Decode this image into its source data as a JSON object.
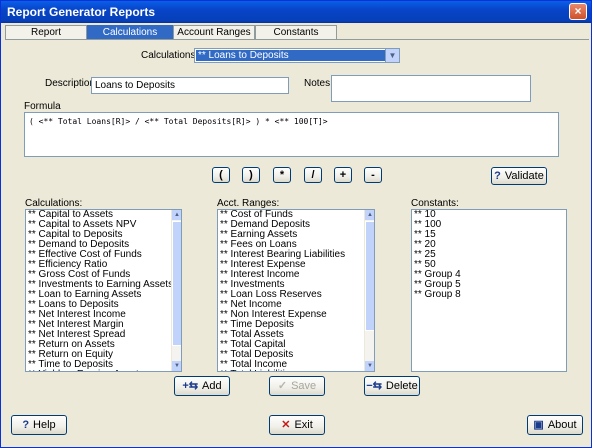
{
  "window": {
    "title": "Report Generator Reports",
    "close_glyph": "×"
  },
  "tabs": [
    {
      "label": "Report",
      "active": false
    },
    {
      "label": "Calculations",
      "active": true
    },
    {
      "label": "Account Ranges",
      "active": false
    },
    {
      "label": "Constants",
      "active": false
    }
  ],
  "calc_select": {
    "label": "Calculations:",
    "value": "** Loans to Deposits"
  },
  "description": {
    "label": "Description",
    "value": "Loans to Deposits"
  },
  "notes": {
    "label": "Notes",
    "value": ""
  },
  "formula": {
    "label": "Formula",
    "value": "( <** Total Loans[R]> / <** Total Deposits[R]> )  * <** 100[T]>"
  },
  "operators": [
    "(",
    ")",
    "*",
    "/",
    "+",
    "-"
  ],
  "validate": {
    "label": "Validate",
    "icon": "?"
  },
  "calculations": {
    "label": "Calculations:",
    "items": [
      "** Capital to Assets",
      "** Capital to Assets NPV",
      "** Capital to Deposits",
      "** Demand to Deposits",
      "** Effective Cost of Funds",
      "** Efficiency Ratio",
      "** Gross Cost of Funds",
      "** Investments to Earning Assets",
      "** Loan to Earning Assets",
      "** Loans to Deposits",
      "** Net Interest Income",
      "** Net Interest Margin",
      "** Net Interest Spread",
      "** Return on Assets",
      "** Return on Equity",
      "** Time to Deposits",
      "** Yield on Earning Assets"
    ]
  },
  "acct_ranges": {
    "label": "Acct. Ranges:",
    "items": [
      "** Cost of Funds",
      "** Demand Deposits",
      "** Earning Assets",
      "** Fees on Loans",
      "** Interest Bearing Liabilities",
      "** Interest Expense",
      "** Interest Income",
      "** Investments",
      "** Loan Loss Reserves",
      "** Net Income",
      "** Non Interest Expense",
      "** Time Deposits",
      "** Total Assets",
      "** Total Capital",
      "** Total Deposits",
      "** Total Income",
      "** Total Liabilities"
    ]
  },
  "constants": {
    "label": "Constants:",
    "items": [
      "** 10",
      "** 100",
      "** 15",
      "** 20",
      "** 25",
      "** 50",
      "** Group 4",
      "** Group 5",
      "** Group 8"
    ]
  },
  "actions": {
    "add": "Add",
    "save": "Save",
    "delete": "Delete"
  },
  "footer": {
    "help": "Help",
    "exit": "Exit",
    "about": "About"
  }
}
